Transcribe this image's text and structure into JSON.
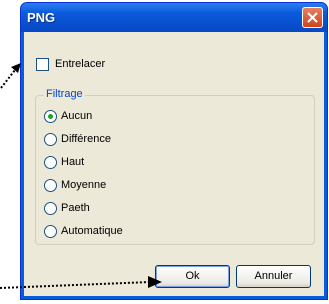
{
  "window": {
    "title": "PNG"
  },
  "options": {
    "interlace_label": "Entrelacer",
    "interlace_checked": false
  },
  "filter": {
    "group_label": "Filtrage",
    "options": [
      "Aucun",
      "Différence",
      "Haut",
      "Moyenne",
      "Paeth",
      "Automatique"
    ],
    "selected": "Aucun"
  },
  "buttons": {
    "ok_label": "Ok",
    "cancel_label": "Annuler"
  },
  "colors": {
    "title_bar": "#0a5cd8",
    "dialog_background": "#ece9d8",
    "group_title": "#0046d5",
    "close_button": "#d0431c"
  },
  "icons": {
    "close": "close-icon",
    "annotation_arrows": "arrow-icon"
  }
}
